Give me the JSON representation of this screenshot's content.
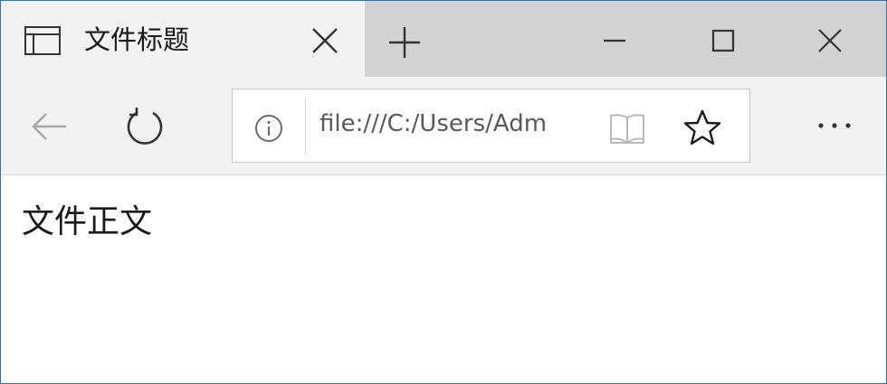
{
  "tab": {
    "title": "文件标题"
  },
  "address_bar": {
    "url": "file:///C:/Users/Adm"
  },
  "page": {
    "body_text": "文件正文"
  },
  "icons": {
    "tab_page": "page-icon",
    "tab_close": "close-icon",
    "new_tab": "plus-icon",
    "minimize": "minimize-icon",
    "maximize": "maximize-icon",
    "window_close": "close-icon",
    "back": "back-arrow-icon",
    "refresh": "refresh-icon",
    "site_info": "info-icon",
    "reading_view": "book-icon",
    "favorite": "star-icon",
    "more": "more-icon"
  },
  "colors": {
    "window_border": "#2f73b8",
    "titlebar_bg": "#d2d2d2",
    "active_tab_bg": "#f2f2f2",
    "disabled_icon": "#a6a6a6"
  }
}
